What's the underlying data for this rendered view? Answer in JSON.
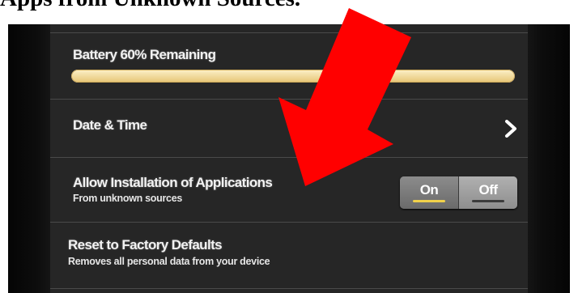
{
  "caption": "Apps from Unknown Sources.",
  "battery": {
    "label": "Battery 60% Remaining",
    "level_percent": 100
  },
  "date_time": {
    "label": "Date & Time",
    "icon": "chevron-right-icon"
  },
  "unknown_sources": {
    "label": "Allow Installation of Applications",
    "sublabel": "From unknown sources",
    "toggle": {
      "on_label": "On",
      "off_label": "Off",
      "selected": "On"
    }
  },
  "factory_reset": {
    "label": "Reset to Factory Defaults",
    "sublabel": "Removes all personal data from your device"
  },
  "colors": {
    "arrow": "#ff0000",
    "on_indicator": "#f1d14a",
    "battery_fill": "#e7c77a"
  }
}
